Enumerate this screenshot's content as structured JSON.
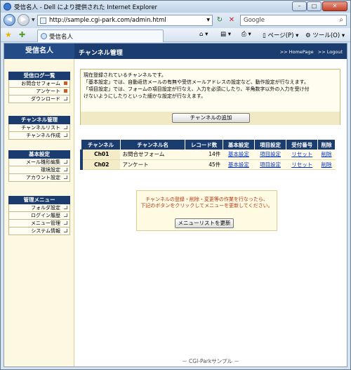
{
  "window": {
    "title": "受信名人 - Dell により提供された Internet Explorer",
    "min": "–",
    "max": "□",
    "close": "✕"
  },
  "browser": {
    "url": "http://sample.cgi-park.com/admin.html",
    "search_placeholder": "Google",
    "tab_title": "受信名人",
    "page_menu": "ページ(P)",
    "tools_menu": "ツール(O)",
    "back": "◀",
    "forward": "▶"
  },
  "header": {
    "brand": "受信名人",
    "page_title": "チャンネル管理",
    "homepage": ">> HomePage",
    "logout": ">> Logout"
  },
  "sidebar": [
    {
      "title": "受信ログ一覧",
      "items": [
        "お問合せフォーム",
        "アンケート",
        "ダウンロード"
      ]
    },
    {
      "title": "チャンネル管理",
      "items": [
        "チャンネルリスト",
        "チャンネル作成"
      ]
    },
    {
      "title": "基本設定",
      "items": [
        "メール雛形編集",
        "環境設定",
        "アカウント設定"
      ]
    },
    {
      "title": "管理メニュー",
      "items": [
        "フォルダ設定",
        "ログイン履歴",
        "メニュー管理",
        "システム情報"
      ]
    }
  ],
  "info": {
    "lines": [
      "現在登録されているチャンネルです。",
      "「基本設定」では、自動返信メールの有無や受信メールアドレスの設定など、動作設定が行なえます。",
      "「項目設定」では、フォームの項目設定が行なえ、入力を必須にしたり、半角数字以外の入力を受け付",
      "けないようにしたりといった細かな設定が行なえます。"
    ],
    "add_button": "チャンネルの追加"
  },
  "table": {
    "headers": [
      "チャンネル",
      "チャンネル名",
      "レコード数",
      "基本設定",
      "項目設定",
      "受付番号",
      "削除"
    ],
    "rows": [
      {
        "id": "Ch01",
        "name": "お問合せフォーム",
        "records": "14件",
        "basic": "基本設定",
        "items": "項目設定",
        "reset": "リセット",
        "delete": "削除"
      },
      {
        "id": "Ch02",
        "name": "アンケート",
        "records": "45件",
        "basic": "基本設定",
        "items": "項目設定",
        "reset": "リセット",
        "delete": "削除"
      }
    ]
  },
  "notice": {
    "lines": [
      "チャンネルの登録・削除・変更等の作業を行なったら、",
      "下記のボタンをクリックしてメニューを更新してください。"
    ],
    "button": "メニューリストを更新"
  },
  "footer": "－ CGI-Parkサンプル －"
}
